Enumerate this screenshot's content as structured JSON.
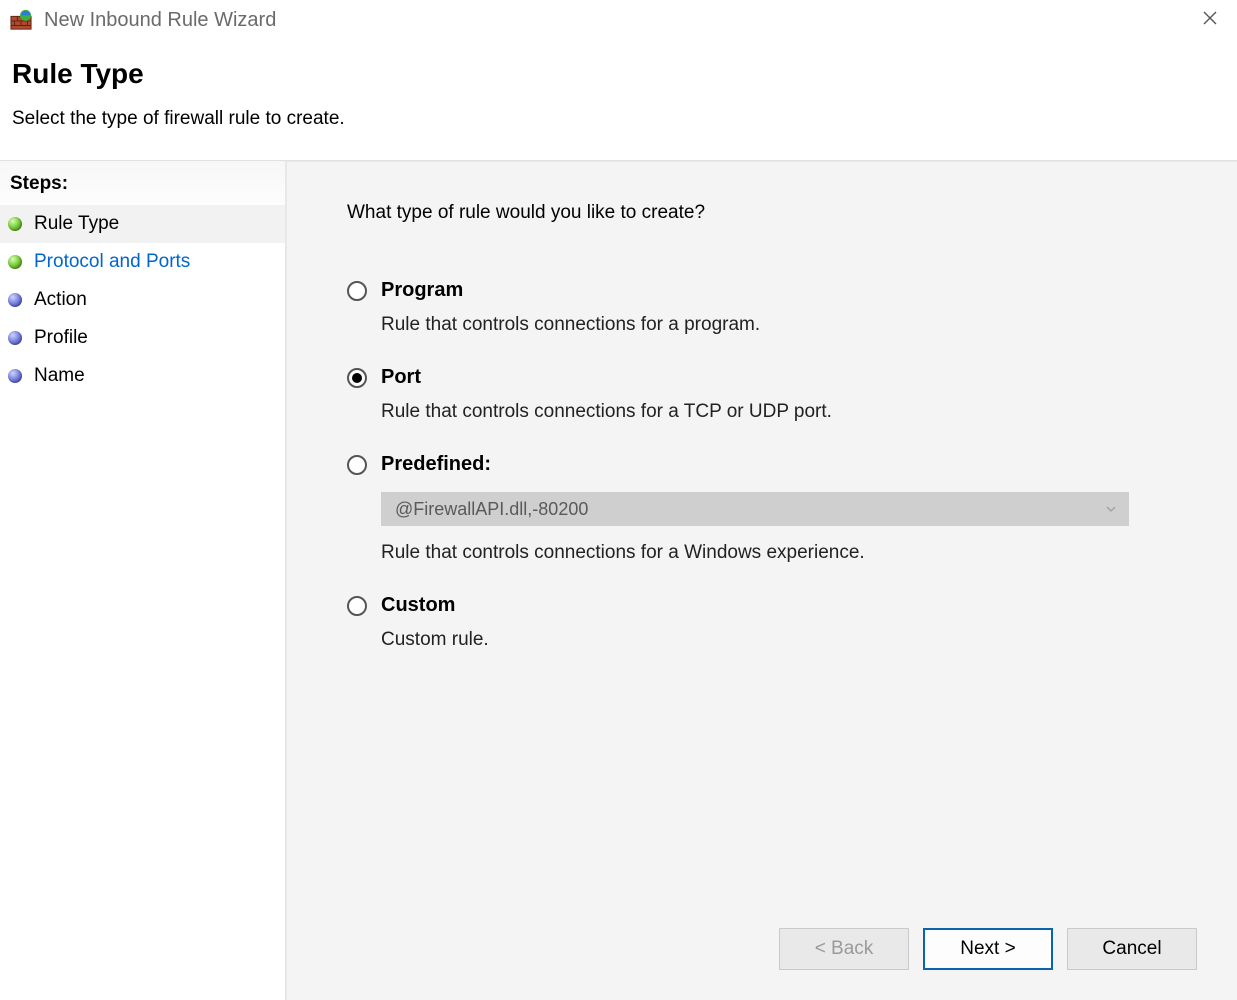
{
  "window": {
    "title": "New Inbound Rule Wizard"
  },
  "header": {
    "title": "Rule Type",
    "subtitle": "Select the type of firewall rule to create."
  },
  "steps": {
    "heading": "Steps:",
    "items": [
      {
        "label": "Rule Type",
        "bullet": "green",
        "active": true,
        "link": false
      },
      {
        "label": "Protocol and Ports",
        "bullet": "green",
        "active": false,
        "link": true
      },
      {
        "label": "Action",
        "bullet": "blue",
        "active": false,
        "link": false
      },
      {
        "label": "Profile",
        "bullet": "blue",
        "active": false,
        "link": false
      },
      {
        "label": "Name",
        "bullet": "blue",
        "active": false,
        "link": false
      }
    ]
  },
  "main": {
    "prompt": "What type of rule would you like to create?",
    "options": [
      {
        "id": "program",
        "label": "Program",
        "desc": "Rule that controls connections for a program.",
        "selected": false
      },
      {
        "id": "port",
        "label": "Port",
        "desc": "Rule that controls connections for a TCP or UDP port.",
        "selected": true
      },
      {
        "id": "predefined",
        "label": "Predefined:",
        "desc": "Rule that controls connections for a Windows experience.",
        "selected": false,
        "dropdown_value": "@FirewallAPI.dll,-80200",
        "dropdown_enabled": false
      },
      {
        "id": "custom",
        "label": "Custom",
        "desc": "Custom rule.",
        "selected": false
      }
    ]
  },
  "buttons": {
    "back": "< Back",
    "next": "Next >",
    "cancel": "Cancel"
  }
}
